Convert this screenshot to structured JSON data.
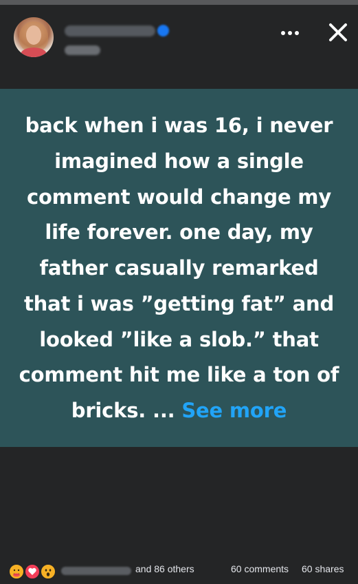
{
  "post": {
    "author": {
      "avatar_icon": "avatar-photo",
      "verified_icon": "verified-badge-icon"
    },
    "header_actions": {
      "more_icon": "more-horizontal-icon",
      "close_icon": "close-icon"
    },
    "background_color": "#2d5459",
    "text_main": "back when i was 16, i never imagined how a single comment would change my life forever. one day, my father casually remarked that i was ”getting fat” and looked ”like a slob.” that comment hit me like a ton of bricks. ...",
    "see_more_label": "See more",
    "see_more_color": "#21a4f7"
  },
  "footer": {
    "reaction_icons": [
      "care-reaction-icon",
      "love-reaction-icon",
      "wow-reaction-icon"
    ],
    "reactions_others": "and 86 others",
    "comments": "60 comments",
    "shares": "60 shares"
  }
}
